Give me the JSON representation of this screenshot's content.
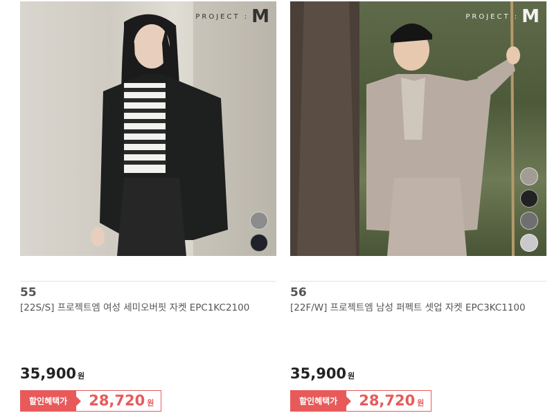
{
  "products": [
    {
      "rank": "55",
      "title": "[22S/S] 프로젝트엠 여성 세미오버핏 자켓 EPC1KC2100",
      "price": "35,900",
      "currency": "원",
      "discount_label": "할인혜택가",
      "sale_price": "28,720",
      "brand_logo_text": "PROJECT :",
      "brand_logo_mark": "M",
      "swatches": [
        "#8c8c8c",
        "#1f2228"
      ]
    },
    {
      "rank": "56",
      "title": "[22F/W] 프로젝트엠 남성 퍼펙트 셋업 자켓 EPC3KC1100",
      "price": "35,900",
      "currency": "원",
      "discount_label": "할인혜택가",
      "sale_price": "28,720",
      "brand_logo_text": "PROJECT :",
      "brand_logo_mark": "M",
      "swatches": [
        "#a39c95",
        "#222222",
        "#6f6f6f",
        "#c9c9cc"
      ]
    }
  ]
}
